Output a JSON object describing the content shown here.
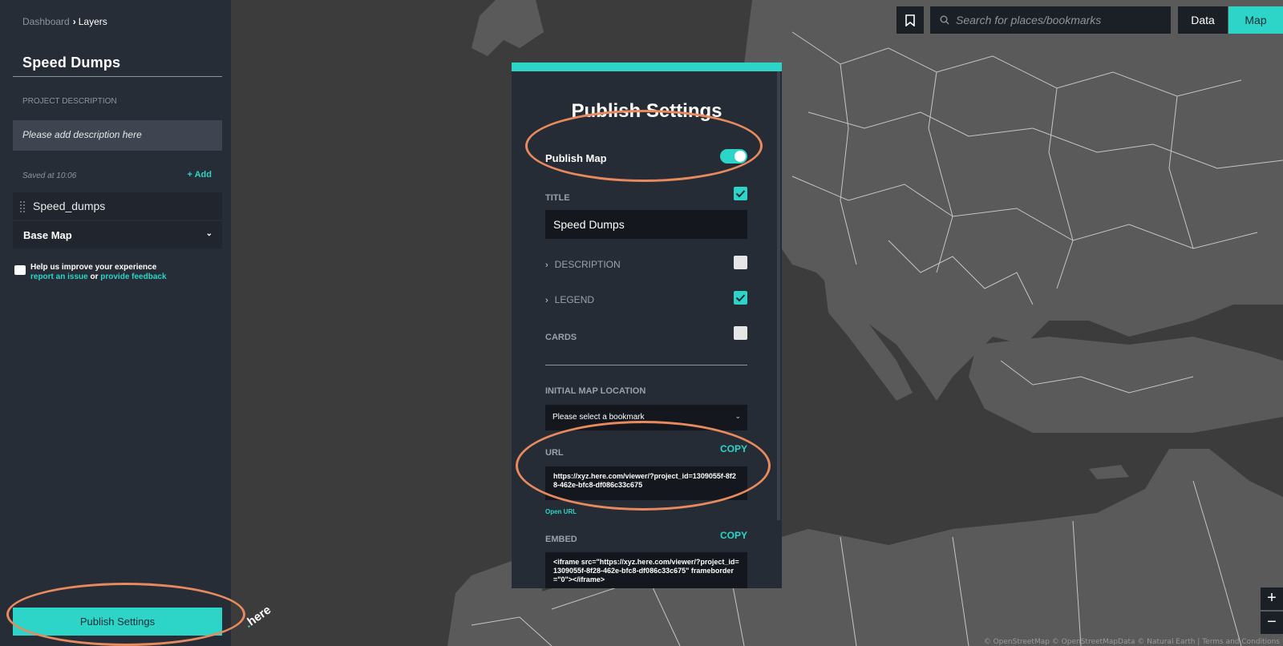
{
  "sidebar": {
    "breadcrumb": {
      "parent": "Dashboard",
      "separator": "›",
      "current": "Layers"
    },
    "project_title": "Speed Dumps",
    "description_label": "PROJECT DESCRIPTION",
    "description_placeholder": "Please add description here",
    "saved_text": "Saved at 10:06",
    "add_label": "+ Add",
    "layers": [
      {
        "name": "Speed_dumps"
      }
    ],
    "base_map_label": "Base Map",
    "help": {
      "text": "Help us improve your experience",
      "report_link": "report an issue",
      "or": "or",
      "feedback_link": "provide feedback"
    },
    "publish_button": "Publish Settings"
  },
  "toolbar": {
    "search_placeholder": "Search for places/bookmarks",
    "data_label": "Data",
    "map_label": "Map",
    "zoom_in": "+",
    "zoom_out": "−"
  },
  "logo": {
    "brand": "here"
  },
  "publish_panel": {
    "title": "Publish Settings",
    "publish_map_label": "Publish Map",
    "publish_map_enabled": true,
    "title_label": "TITLE",
    "title_checked": true,
    "title_value": "Speed Dumps",
    "description_label": "DESCRIPTION",
    "description_checked": false,
    "legend_label": "LEGEND",
    "legend_checked": true,
    "cards_label": "CARDS",
    "cards_checked": false,
    "initial_location_label": "INITIAL MAP LOCATION",
    "bookmark_select_value": "Please select a bookmark",
    "url_label": "URL",
    "copy_label": "COPY",
    "url_value": "https://xyz.here.com/viewer/?project_id=1309055f-8f28-462e-bfc8-df086c33c675",
    "open_url_label": "Open URL",
    "embed_label": "EMBED",
    "embed_value": "<iframe src=\"https://xyz.here.com/viewer/?project_id=1309055f-8f28-462e-bfc8-df086c33c675\" frameborder=\"0\"></iframe>"
  },
  "attribution": "© OpenStreetMap © OpenStreetMapData © Natural Earth | Terms and Conditions",
  "colors": {
    "accent": "#2dd4c8",
    "sidebar_bg": "#272d36",
    "panel_bg": "#262c36",
    "highlight": "#e98a5e",
    "land": "#5a5a5a",
    "sea": "#3c3c3c"
  },
  "icons": [
    "bookmark-icon",
    "search-icon",
    "drag-handle-icon",
    "chevron-down-icon",
    "check-icon",
    "caret-right-icon"
  ]
}
